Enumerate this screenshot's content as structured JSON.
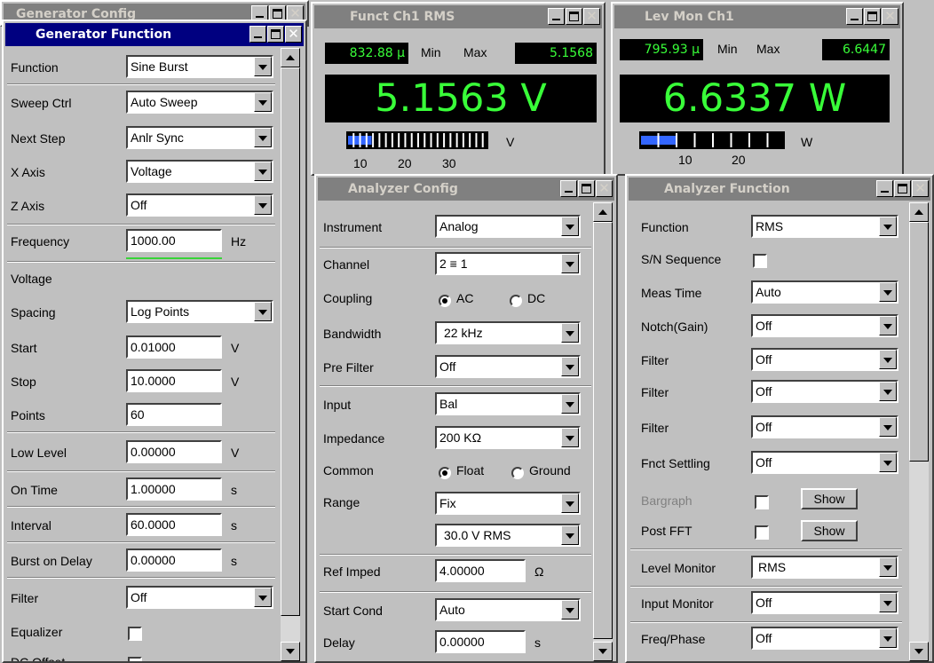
{
  "bg_window": {
    "title": "Generator Config"
  },
  "generator": {
    "title": "Generator Function",
    "rows": {
      "function": {
        "label": "Function",
        "value": "Sine Burst"
      },
      "sweep": {
        "label": "Sweep Ctrl",
        "value": "Auto Sweep"
      },
      "next": {
        "label": "Next Step",
        "value": "Anlr Sync"
      },
      "xaxis": {
        "label": "X Axis",
        "value": "Voltage"
      },
      "zaxis": {
        "label": "Z Axis",
        "value": "Off"
      },
      "freq": {
        "label": "Frequency",
        "value": "1000.00",
        "unit": "Hz"
      },
      "voltage": {
        "label": "Voltage"
      },
      "spacing": {
        "label": "Spacing",
        "value": "Log Points"
      },
      "start": {
        "label": "Start",
        "value": "0.01000",
        "unit": "V"
      },
      "stop": {
        "label": "Stop",
        "value": "10.0000",
        "unit": "V"
      },
      "points": {
        "label": "Points",
        "value": "60"
      },
      "low": {
        "label": "Low Level",
        "value": "0.00000",
        "unit": "V"
      },
      "ontime": {
        "label": "On Time",
        "value": "1.00000",
        "unit": "s"
      },
      "interval": {
        "label": "Interval",
        "value": "60.0000",
        "unit": "s"
      },
      "delay": {
        "label": "Burst on Delay",
        "value": "0.00000",
        "unit": "s"
      },
      "filter": {
        "label": "Filter",
        "value": "Off"
      },
      "eq": {
        "label": "Equalizer"
      },
      "dc": {
        "label": "DC Offset"
      }
    }
  },
  "funct_rms": {
    "title": "Funct Ch1 RMS",
    "min_value": "832.88 µ",
    "min_label": "Min",
    "max_label": "Max",
    "max_value": "5.1568",
    "reading": "5.1563 V",
    "bar_unit": "V",
    "ticks": [
      "10",
      "20",
      "30"
    ],
    "bar_level": 0.17
  },
  "lev_mon": {
    "title": "Lev Mon Ch1",
    "min_value": "795.93 µ",
    "min_label": "Min",
    "max_label": "Max",
    "max_value": "6.6447",
    "reading": "6.6337 W",
    "bar_unit": "W",
    "ticks": [
      "10",
      "20"
    ],
    "bar_level": 0.25
  },
  "analyzer_config": {
    "title": "Analyzer Config",
    "rows": {
      "instrument": {
        "label": "Instrument",
        "value": "Analog"
      },
      "channel": {
        "label": "Channel",
        "value": "2 ≡ 1"
      },
      "coupling": {
        "label": "Coupling",
        "opt1": "AC",
        "opt2": "DC"
      },
      "bandwidth": {
        "label": "Bandwidth",
        "value": "22 kHz"
      },
      "prefilter": {
        "label": "Pre Filter",
        "value": "Off"
      },
      "input": {
        "label": "Input",
        "value": "Bal"
      },
      "impedance": {
        "label": "Impedance",
        "value": "200 KΩ"
      },
      "common": {
        "label": "Common",
        "opt1": "Float",
        "opt2": "Ground"
      },
      "range": {
        "label": "Range",
        "value": "Fix",
        "value2": "30.0 V RMS"
      },
      "refimped": {
        "label": "Ref Imped",
        "value": "4.00000",
        "unit": "Ω"
      },
      "startcond": {
        "label": "Start Cond",
        "value": "Auto"
      },
      "delay": {
        "label": "Delay",
        "value": "0.00000",
        "unit": "s"
      }
    }
  },
  "analyzer_function": {
    "title": "Analyzer Function",
    "rows": {
      "function": {
        "label": "Function",
        "value": "RMS"
      },
      "sn": {
        "label": "S/N Sequence"
      },
      "meastime": {
        "label": "Meas Time",
        "value": "Auto"
      },
      "notch": {
        "label": "Notch(Gain)",
        "value": "Off"
      },
      "filter1": {
        "label": "Filter",
        "value": "Off"
      },
      "filter2": {
        "label": "Filter",
        "value": "Off"
      },
      "filter3": {
        "label": "Filter",
        "value": "Off"
      },
      "fnct": {
        "label": "Fnct Settling",
        "value": "Off"
      },
      "bargraph": {
        "label": "Bargraph",
        "button": "Show"
      },
      "postfft": {
        "label": "Post FFT",
        "button": "Show"
      },
      "levelmon": {
        "label": "Level Monitor",
        "value": "RMS"
      },
      "inputmon": {
        "label": "Input Monitor",
        "value": "Off"
      },
      "freqphase": {
        "label": "Freq/Phase",
        "value": "Off"
      }
    }
  },
  "colors": {
    "title_active": "#000080",
    "title_inactive": "#808080",
    "lcd_text": "#39ff39",
    "bar_fill": "#3366ff"
  }
}
